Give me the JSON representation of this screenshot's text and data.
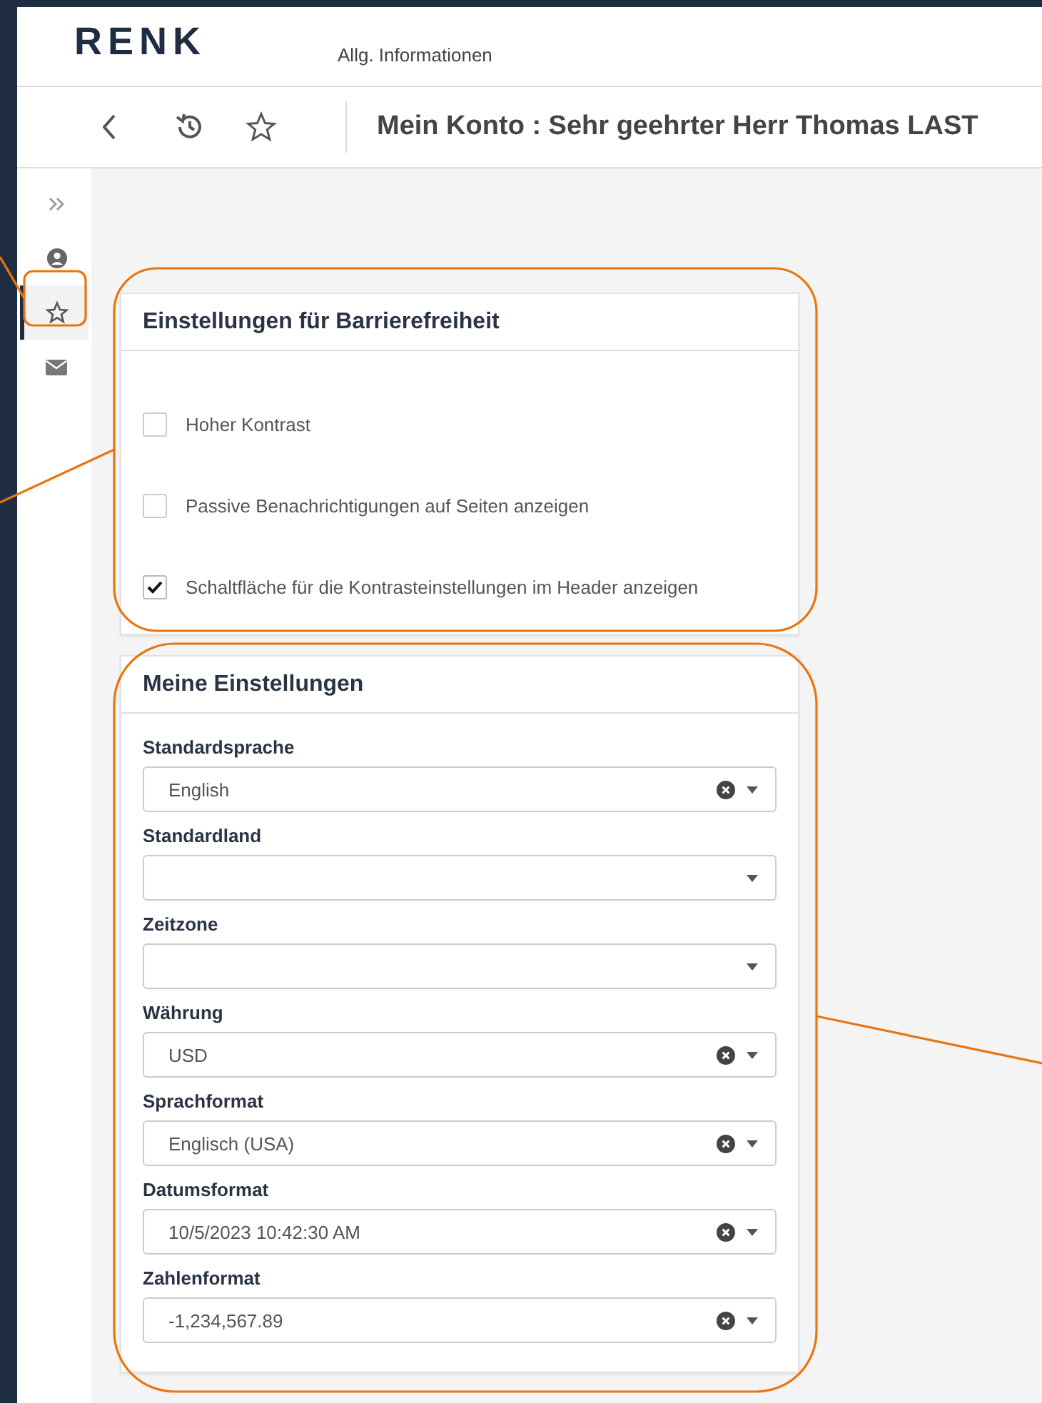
{
  "header": {
    "logo": "RENK",
    "tab": "Allg. Informationen"
  },
  "toolbar": {
    "title": "Mein Konto : Sehr geehrter Herr Thomas LAST"
  },
  "sidebar": {
    "items": [
      {
        "kind": "expand",
        "selected": false
      },
      {
        "kind": "user",
        "selected": false
      },
      {
        "kind": "star",
        "selected": true
      },
      {
        "kind": "mail",
        "selected": false
      }
    ]
  },
  "accessibility": {
    "title": "Einstellungen für Barrierefreiheit",
    "options": [
      {
        "label": "Hoher Kontrast",
        "checked": false
      },
      {
        "label": "Passive Benachrichtigungen auf Seiten anzeigen",
        "checked": false
      },
      {
        "label": "Schaltfläche für die Kontrasteinstellungen im Header anzeigen",
        "checked": true
      }
    ]
  },
  "settings": {
    "title": "Meine Einstellungen",
    "fields": [
      {
        "label": "Standardsprache",
        "value": "English",
        "clearable": true
      },
      {
        "label": "Standardland",
        "clearable": false
      },
      {
        "label": "Zeitzone",
        "clearable": false
      },
      {
        "label": "Währung",
        "value": "USD",
        "clearable": true
      },
      {
        "label": "Sprachformat",
        "value": "Englisch (USA)",
        "clearable": true
      },
      {
        "label": "Datumsformat",
        "value": "10/5/2023 10:42:30 AM",
        "clearable": true
      },
      {
        "label": "Zahlenformat",
        "value": "-1,234,567.89",
        "clearable": true
      }
    ]
  }
}
